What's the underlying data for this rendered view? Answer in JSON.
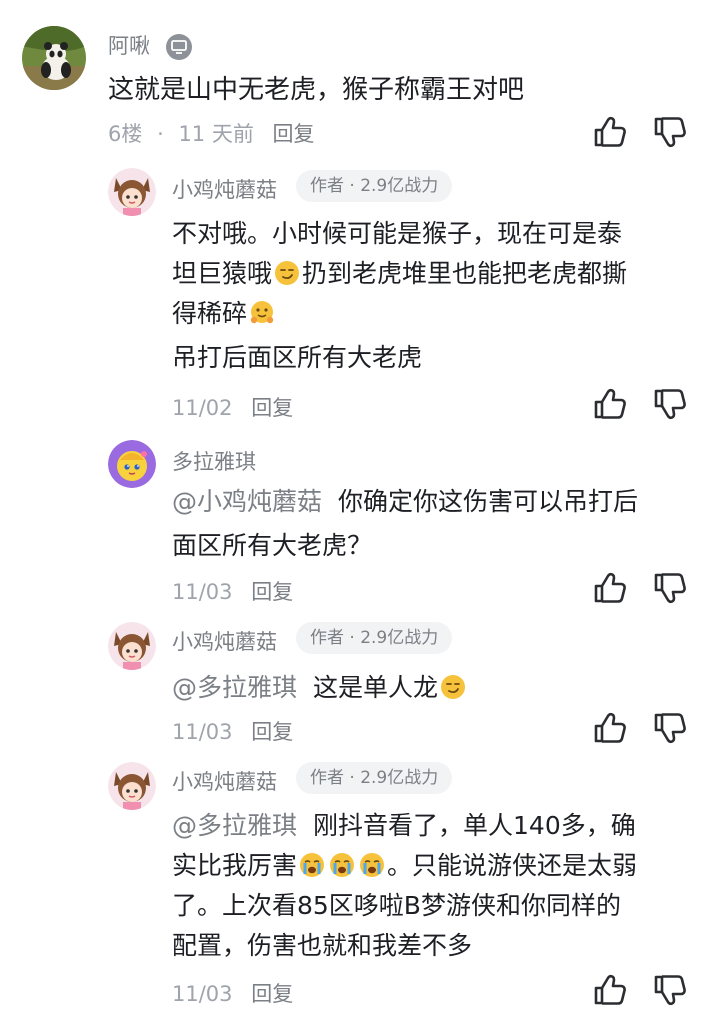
{
  "main_comment": {
    "username": "阿啾",
    "device_icon": "computer-icon",
    "text": "这就是山中无老虎，猴子称霸王对吧",
    "floor": "6楼",
    "separator": "·",
    "time": "11 天前",
    "reply_label": "回复"
  },
  "replies": [
    {
      "username": "小鸡炖蘑菇",
      "badge": "作者 · 2.9亿战力",
      "lines": [
        "不对哦。小时候可能是猴子，现在可是泰",
        "坦巨猿哦",
        "扔到老虎堆里也能把老虎都撕",
        "得稀碎",
        "吊打后面区所有大老虎"
      ],
      "date": "11/02",
      "reply_label": "回复"
    },
    {
      "username": "多拉雅琪",
      "mention": "@小鸡炖蘑菇",
      "lines": [
        "你确定你这伤害可以吊打后",
        "面区所有大老虎？"
      ],
      "date": "11/03",
      "reply_label": "回复"
    },
    {
      "username": "小鸡炖蘑菇",
      "badge": "作者 · 2.9亿战力",
      "mention": "@多拉雅琪",
      "lines": [
        "这是单人龙"
      ],
      "date": "11/03",
      "reply_label": "回复"
    },
    {
      "username": "小鸡炖蘑菇",
      "badge": "作者 · 2.9亿战力",
      "mention": "@多拉雅琪",
      "lines": [
        "刚抖音看了，单人140多，确",
        "实比我厉害",
        "。只能说游侠还是太弱",
        "了。上次看85区哆啦B梦游侠和你同样的",
        "配置，伤害也就和我差不多"
      ],
      "date": "11/03",
      "reply_label": "回复"
    }
  ],
  "icons": {
    "like": "thumbs-up-icon",
    "dislike": "thumbs-down-icon",
    "emoji_smirk": "smirk-emoji-icon",
    "emoji_hug": "hugging-emoji-icon",
    "emoji_cry": "loudly-crying-emoji-icon"
  },
  "colors": {
    "text": "#1d1f24",
    "secondary": "#7b7f86",
    "meta": "#9fa3ab",
    "badge_bg": "#f2f3f5"
  }
}
